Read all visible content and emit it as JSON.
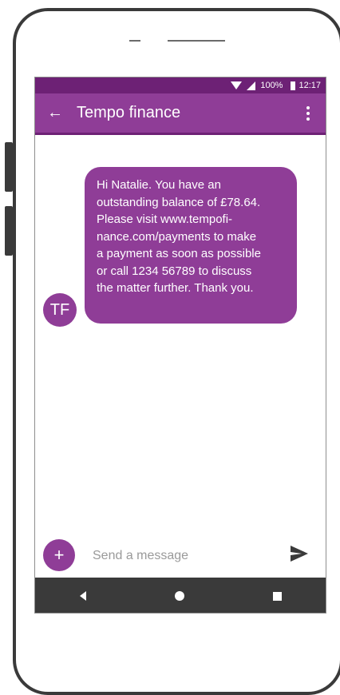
{
  "status_bar": {
    "battery": "100%",
    "time": "12:17"
  },
  "header": {
    "title": "Tempo finance"
  },
  "conversation": {
    "message": "Hi Natalie. You have an\noutstanding balance of £78.64.\nPlease visit www.tempofi-\nnance.com/payments to make\na payment as soon as possible\nor call 1234 56789 to discuss\nthe matter further. Thank you.",
    "sender_initials": "TF"
  },
  "compose": {
    "placeholder": "Send a message",
    "add_label": "+"
  },
  "colors": {
    "accent": "#8f3d97",
    "status_bar": "#6d2175",
    "nav_bar": "#3a3a3a"
  },
  "icons": [
    "back-arrow-icon",
    "overflow-menu-icon",
    "wifi-icon",
    "signal-icon",
    "battery-icon",
    "add-icon",
    "send-icon",
    "nav-back-icon",
    "nav-home-icon",
    "nav-recent-icon"
  ]
}
